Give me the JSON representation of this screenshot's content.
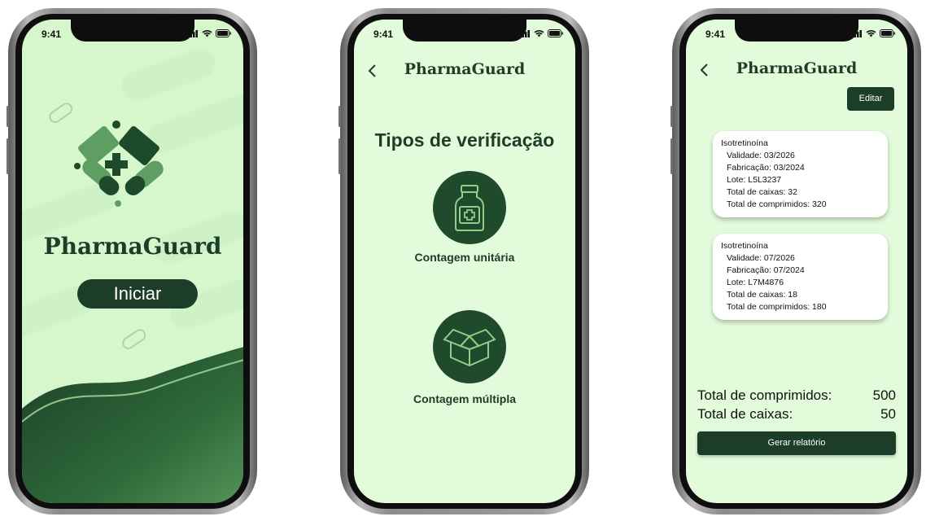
{
  "status_bar": {
    "time": "9:41"
  },
  "app": {
    "name": "PharmaGuard"
  },
  "splash": {
    "start_button": "Iniciar"
  },
  "verification": {
    "heading": "Tipos de verificação",
    "options": [
      {
        "label": "Contagem unitária",
        "icon": "medicine-bottle-icon"
      },
      {
        "label": "Contagem múltipla",
        "icon": "open-box-icon"
      }
    ]
  },
  "summary": {
    "edit_button": "Editar",
    "items": [
      {
        "name": "Isotretinoína",
        "validade": "Validade: 03/2026",
        "fabricacao": "Fabricação: 03/2024",
        "lote": "Lote: L5L3237",
        "caixas": "Total de caixas: 32",
        "comprimidos": "Total de comprimidos: 320"
      },
      {
        "name": "Isotretinoína",
        "validade": "Validade: 07/2026",
        "fabricacao": "Fabricação: 07/2024",
        "lote": "Lote: L7M4876",
        "caixas": "Total de caixas: 18",
        "comprimidos": "Total de comprimidos: 180"
      }
    ],
    "total_pills_label": "Total de comprimidos:",
    "total_pills_value": "500",
    "total_boxes_label": "Total de caixas:",
    "total_boxes_value": "50",
    "report_button": "Gerar relatório"
  },
  "colors": {
    "dark_green": "#1c3d28",
    "light_green": "#e2fbdb",
    "accent_green": "#3f7d47"
  }
}
